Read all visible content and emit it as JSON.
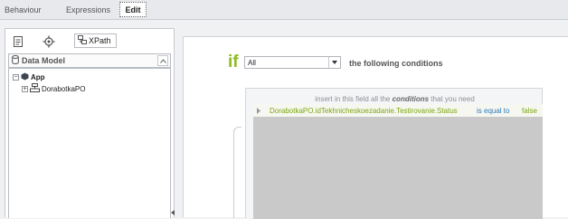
{
  "tabs": [
    {
      "label": "Behaviour"
    },
    {
      "label": "Expressions"
    },
    {
      "label": "Edit",
      "active": true
    }
  ],
  "left_panel": {
    "tools": [
      {
        "icon": "document-icon"
      },
      {
        "icon": "gear-icon"
      },
      {
        "icon": "xpath-icon",
        "label": "XPath"
      }
    ],
    "section_title": "Data Model",
    "tree": [
      {
        "label": "App",
        "expanded": true,
        "icon": "app-icon"
      },
      {
        "label": "DorabotkaPO",
        "expanded": false,
        "icon": "entity-icon"
      }
    ]
  },
  "editor": {
    "keyword": "if",
    "quantifier": {
      "selected": "All"
    },
    "conditions_suffix": "the following conditions",
    "hint": {
      "before": "insert in this field all the",
      "emphasis": "conditions",
      "after": "that you need"
    },
    "conditions": [
      {
        "field": "DorabotkaPO.idTekhnicheskoezadanie.Testirovanie.Status",
        "operator": "is equal to",
        "value": "false"
      }
    ]
  },
  "colors": {
    "keyword_green": "#8dbb22",
    "operator_blue": "#2b7ab8"
  }
}
